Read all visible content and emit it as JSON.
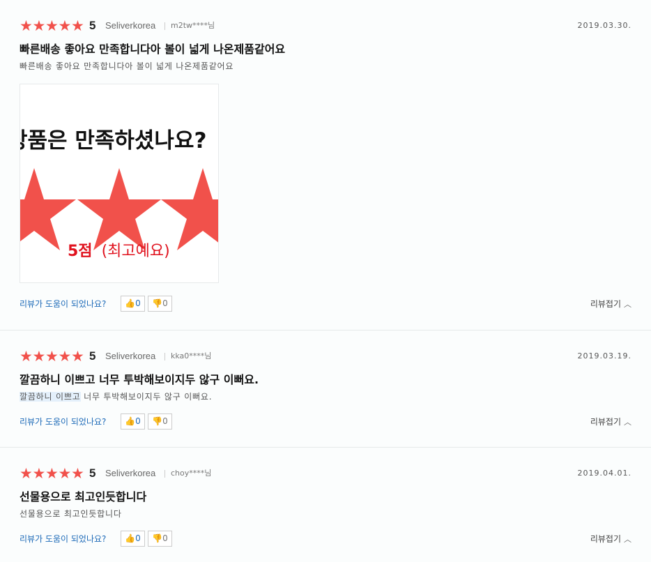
{
  "reviews": [
    {
      "rating_value": 5,
      "score": "5",
      "seller": "Seliverkorea",
      "user": "m2tw****님",
      "date": "2019.03.30.",
      "title": "빠른배송 좋아요 만족합니다아 볼이 넓게 나온제품같어요",
      "body": "빠른배송 좋아요 만족합니다아 볼이 넓게 나온제품같어요",
      "photo": {
        "headline": "상품은 만족하셨나요?",
        "score_text": "5점",
        "score_note": "(최고예요)"
      },
      "helpful_label": "리뷰가 도움이 되었나요?",
      "upvotes": "0",
      "downvotes": "0",
      "fold_label": "리뷰접기"
    },
    {
      "rating_value": 5,
      "score": "5",
      "seller": "Seliverkorea",
      "user": "kka0****님",
      "date": "2019.03.19.",
      "title": "깔끔하니 이쁘고 너무 투박해보이지두 않구 이뻐요.",
      "body_highlight": "깔끔하니 이쁘고",
      "body_rest": " 너무 투박해보이지두 않구 이뻐요.",
      "helpful_label": "리뷰가 도움이 되었나요?",
      "upvotes": "0",
      "downvotes": "0",
      "fold_label": "리뷰접기"
    },
    {
      "rating_value": 5,
      "score": "5",
      "seller": "Seliverkorea",
      "user": "choy****님",
      "date": "2019.04.01.",
      "title": "선물용으로 최고인듯합니다",
      "body": "선물용으로 최고인듯합니다",
      "helpful_label": "리뷰가 도움이 되었나요?",
      "upvotes": "0",
      "downvotes": "0",
      "fold_label": "리뷰접기"
    }
  ],
  "icons": {
    "star": "star-icon",
    "thumb_up": "thumbs-up-icon",
    "thumb_down": "thumbs-down-icon",
    "chevron": "chevron-up-icon"
  },
  "colors": {
    "star": "#f1514b",
    "link": "#1d6ab8",
    "photo_red": "#e0131f"
  }
}
